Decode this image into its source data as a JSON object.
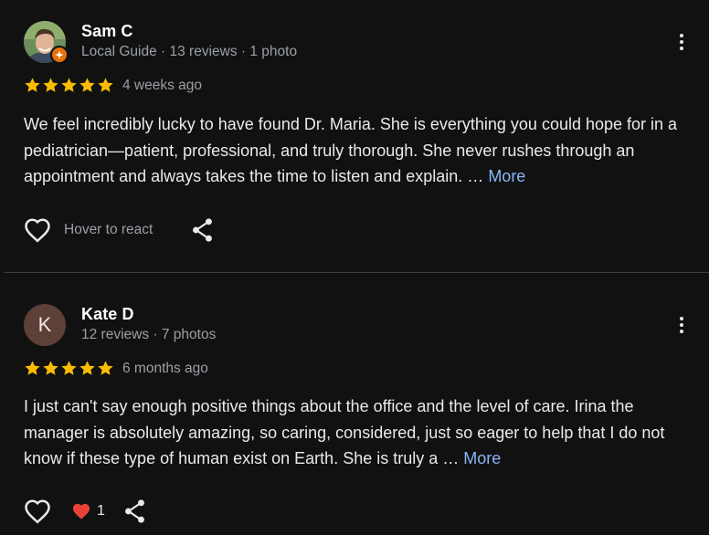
{
  "colors": {
    "background": "#111111",
    "star": "#fbbc04",
    "link": "#8ab4f8",
    "heart_filled": "#ea4335",
    "avatar_kate": "#5d4037",
    "badge": "#e8710a"
  },
  "reviews": [
    {
      "name": "Sam C",
      "meta": "Local Guide · 13 reviews · 1 photo",
      "avatar_type": "photo",
      "badge_icon": "local-guide-badge-icon",
      "rating": 5,
      "date": "4 weeks ago",
      "text": "We feel incredibly lucky to have found Dr. Maria. She is everything you could hope for in a pediatrician—patient, professional, and truly thorough. She never rushes through an appointment and always takes the time to listen and explain. …",
      "more_label": "More",
      "react_label": "Hover to react",
      "icons": [
        "heart-outline-icon",
        "share-icon",
        "more-vert-icon"
      ]
    },
    {
      "name": "Kate D",
      "meta": "12 reviews · 7 photos",
      "avatar_type": "letter",
      "avatar_letter": "K",
      "rating": 5,
      "date": "6 months ago",
      "text": "I just can't say enough positive things about the office and the level of care. Irina the manager is absolutely amazing, so caring, considered, just so eager to help that I do not know if these type of human exist on Earth. She is truly a …",
      "more_label": "More",
      "reaction_count": "1",
      "icons": [
        "heart-outline-icon",
        "heart-filled-icon",
        "share-icon",
        "more-vert-icon"
      ]
    }
  ]
}
